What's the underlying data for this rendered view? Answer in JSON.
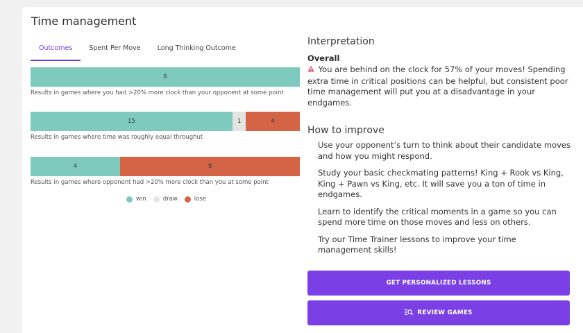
{
  "title": "Time management",
  "tabs": [
    {
      "label": "Outcomes",
      "active": true
    },
    {
      "label": "Spent Per Move",
      "active": false
    },
    {
      "label": "Long Thinking Outcome",
      "active": false
    }
  ],
  "bars": [
    {
      "win": 8,
      "draw": 0,
      "lose": 0,
      "caption": "Results in games where you had >20% more clock than your opponent at some point"
    },
    {
      "win": 15,
      "draw": 1,
      "lose": 4,
      "caption": "Results in games where time was roughly equal throughut"
    },
    {
      "win": 4,
      "draw": 0,
      "lose": 8,
      "caption": "Results in games where opponent had >20% more clock than you at some point"
    }
  ],
  "legend": {
    "win": "win",
    "draw": "draw",
    "lose": "lose"
  },
  "colors": {
    "win": "#7ecbbd",
    "draw": "#e4e4e4",
    "lose": "#d46446",
    "accent": "#7b40e5",
    "tab_active": "#6e3fd6"
  },
  "interpretation": {
    "heading": "Interpretation",
    "overall_heading": "Overall",
    "overall_icon": "alert-icon",
    "overall_text": "You are behind on the clock for 57% of your moves! Spending extra time in critical positions can be helpful, but consistent poor time management will put you at a disadvantage in your endgames."
  },
  "improve": {
    "heading": "How to improve",
    "tips": [
      "Use your opponent’s turn to think about their candidate moves and how you might respond.",
      "Study your basic checkmating patterns! King + Rook vs King, King + Pawn vs King, etc. It will save you a ton of time in endgames.",
      "Learn to identify the critical moments in a game so you can spend more time on those moves and less on others.",
      "Try our Time Trainer lessons to improve your time management skills!"
    ]
  },
  "buttons": {
    "lessons": "GET PERSONALIZED LESSONS",
    "review": "REVIEW GAMES",
    "review_icon": "search-list-icon"
  }
}
